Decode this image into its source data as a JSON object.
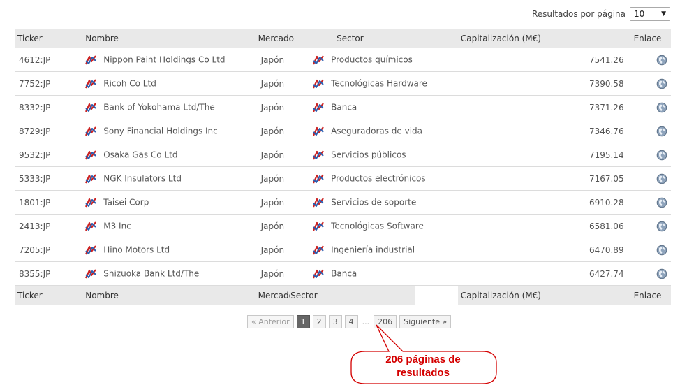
{
  "per_page": {
    "label": "Resultados por página",
    "value": "10"
  },
  "columns": {
    "ticker": "Ticker",
    "nombre": "Nombre",
    "mercado": "Mercado",
    "sector": "Sector",
    "cap": "Capitalización (M€)",
    "enlace": "Enlace"
  },
  "rows": [
    {
      "ticker": "4612:JP",
      "nombre": "Nippon Paint Holdings Co Ltd",
      "mercado": "Japón",
      "sector": "Productos químicos",
      "cap": "7541.26"
    },
    {
      "ticker": "7752:JP",
      "nombre": "Ricoh Co Ltd",
      "mercado": "Japón",
      "sector": "Tecnológicas Hardware",
      "cap": "7390.58"
    },
    {
      "ticker": "8332:JP",
      "nombre": "Bank of Yokohama Ltd/The",
      "mercado": "Japón",
      "sector": "Banca",
      "cap": "7371.26"
    },
    {
      "ticker": "8729:JP",
      "nombre": "Sony Financial Holdings Inc",
      "mercado": "Japón",
      "sector": "Aseguradoras de vida",
      "cap": "7346.76"
    },
    {
      "ticker": "9532:JP",
      "nombre": "Osaka Gas Co Ltd",
      "mercado": "Japón",
      "sector": "Servicios públicos",
      "cap": "7195.14"
    },
    {
      "ticker": "5333:JP",
      "nombre": "NGK Insulators Ltd",
      "mercado": "Japón",
      "sector": "Productos electrónicos",
      "cap": "7167.05"
    },
    {
      "ticker": "1801:JP",
      "nombre": "Taisei Corp",
      "mercado": "Japón",
      "sector": "Servicios de soporte",
      "cap": "6910.28"
    },
    {
      "ticker": "2413:JP",
      "nombre": "M3 Inc",
      "mercado": "Japón",
      "sector": "Tecnológicas Software",
      "cap": "6581.06"
    },
    {
      "ticker": "7205:JP",
      "nombre": "Hino Motors Ltd",
      "mercado": "Japón",
      "sector": "Ingeniería industrial",
      "cap": "6470.89"
    },
    {
      "ticker": "8355:JP",
      "nombre": "Shizuoka Bank Ltd/The",
      "mercado": "Japón",
      "sector": "Banca",
      "cap": "6427.74"
    }
  ],
  "pager": {
    "prev": "« Anterior",
    "pages": [
      "1",
      "2",
      "3",
      "4"
    ],
    "dots": "...",
    "last": "206",
    "next": "Siguiente »"
  },
  "callout": {
    "line1": "206 páginas de",
    "line2": "resultados"
  },
  "colors": {
    "callout_red": "#d40000",
    "header_bg": "#e9e9e9",
    "icon_red": "#cc2222",
    "icon_blue": "#2a5db0"
  },
  "icons": {
    "row_link": "chart-compare-icon",
    "enlace": "globe-icon"
  }
}
